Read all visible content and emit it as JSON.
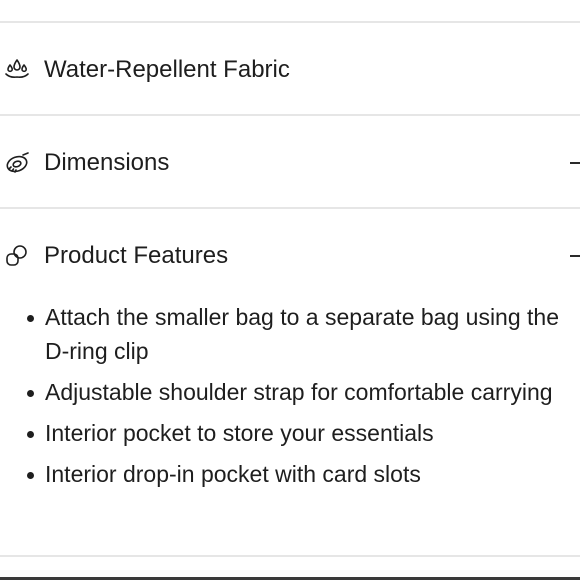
{
  "accordion": {
    "sections": [
      {
        "title": "Water-Repellent Fabric",
        "icon": "water-drops-icon",
        "expanded": false
      },
      {
        "title": "Dimensions",
        "icon": "measuring-tape-icon",
        "expanded": false,
        "toggle": "minus"
      },
      {
        "title": "Product Features",
        "icon": "linked-shapes-icon",
        "expanded": true,
        "toggle": "minus"
      }
    ],
    "features": [
      "Attach the smaller bag to a separate bag using the D-ring clip",
      "Adjustable shoulder strap for comfortable carrying",
      "Interior pocket to store your essentials",
      "Interior drop-in pocket with card slots"
    ]
  },
  "colors": {
    "text": "#1e1e1e",
    "divider": "#e6e6e6",
    "background": "#ffffff"
  }
}
